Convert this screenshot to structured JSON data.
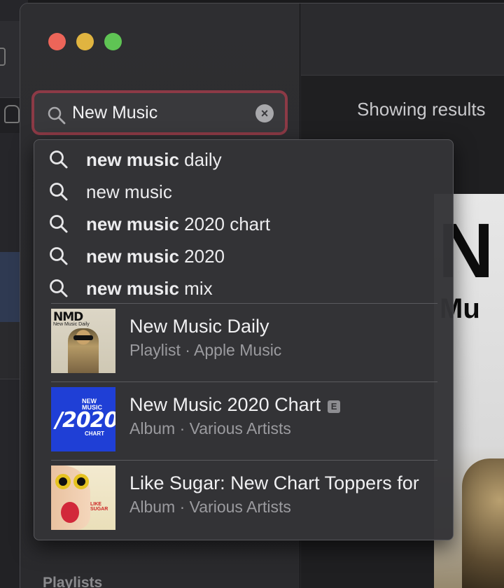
{
  "search": {
    "value": "New Music",
    "clear_symbol": "×"
  },
  "suggestions": [
    {
      "bold": "new music",
      "rest": " daily"
    },
    {
      "bold": "",
      "rest": "new music"
    },
    {
      "bold": "new music",
      "rest": " 2020 chart"
    },
    {
      "bold": "new music",
      "rest": " 2020"
    },
    {
      "bold": "new music",
      "rest": " mix"
    }
  ],
  "results": [
    {
      "title": "New Music Daily",
      "subtitle": "Playlist · Apple Music",
      "explicit": false,
      "art": {
        "logo": "NMD",
        "tag": "New Music Daily"
      }
    },
    {
      "title": "New Music 2020 Chart",
      "subtitle": "Album · Various Artists",
      "explicit": true,
      "explicit_label": "E",
      "art": {
        "top": "NEW MUSIC",
        "year": "/2020/",
        "bottom": "CHART"
      }
    },
    {
      "title": "Like Sugar: New Chart Toppers for",
      "subtitle": "Album · Various Artists",
      "explicit": false,
      "art": {
        "label": "LIKE SUGAR"
      }
    }
  ],
  "sidebar": {
    "section_label": "Playlists"
  },
  "content": {
    "results_text": "Showing results",
    "hero_big": "N",
    "hero_small": "Mu"
  },
  "colors": {
    "search_focus_ring": "#8c3a46",
    "traffic_close": "#ec6559",
    "traffic_minimize": "#e0b440",
    "traffic_maximize": "#5fc454"
  },
  "icons": {
    "search": "search-icon",
    "clear": "clear-icon",
    "explicit": "explicit-badge"
  }
}
